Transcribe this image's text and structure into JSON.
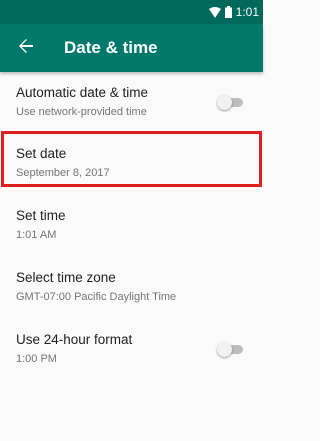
{
  "status_bar": {
    "time": "1:01",
    "icons": [
      "wifi-icon",
      "battery-icon"
    ],
    "bg_color": "#00695c"
  },
  "app_bar": {
    "title": "Date & time",
    "back_icon": "arrow-back-icon",
    "bg_color": "#00796b"
  },
  "settings": [
    {
      "title": "Automatic date & time",
      "summary": "Use network-provided time",
      "toggle": false
    },
    {
      "title": "Set date",
      "summary": "September 8, 2017"
    },
    {
      "title": "Set time",
      "summary": "1:01 AM"
    },
    {
      "title": "Select time zone",
      "summary": "GMT-07:00 Pacific Daylight Time"
    },
    {
      "title": "Use 24-hour format",
      "summary": "1:00 PM",
      "toggle": false
    }
  ],
  "highlight_color": "#e0201f"
}
